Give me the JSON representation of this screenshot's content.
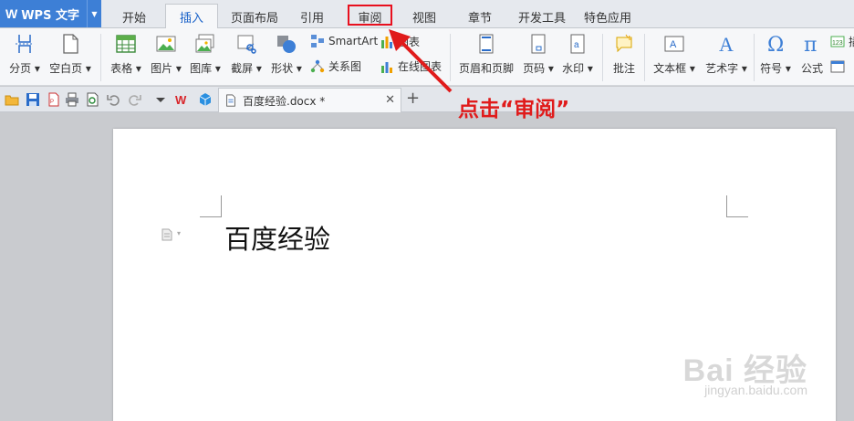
{
  "app": {
    "logo": "W",
    "name": "WPS 文字"
  },
  "tabs": [
    "开始",
    "插入",
    "页面布局",
    "引用",
    "审阅",
    "视图",
    "章节",
    "开发工具",
    "特色应用"
  ],
  "active_tab": "插入",
  "ribbon": {
    "page_break": "分页",
    "blank_page": "空白页",
    "table": "表格",
    "picture": "图片",
    "gallery": "图库",
    "screenshot": "截屏",
    "shapes": "形状",
    "smartart": "SmartArt",
    "chart": "图表",
    "relation_chart": "关系图",
    "online_chart": "在线图表",
    "header_footer": "页眉和页脚",
    "page_number": "页码",
    "watermark": "水印",
    "comment": "批注",
    "textbox": "文本框",
    "wordart": "艺术字",
    "symbol": "符号",
    "formula": "公式",
    "extra": "插"
  },
  "document": {
    "tab_title": "百度经验.docx *",
    "body_text": "百度经验"
  },
  "annotation": "点击“审阅”",
  "watermark": {
    "brand": "Bai 经验",
    "url": "jingyan.baidu.com"
  },
  "colors": {
    "accent": "#3d7fd6",
    "highlight": "#e8101e",
    "annotation": "#e01b1b"
  }
}
